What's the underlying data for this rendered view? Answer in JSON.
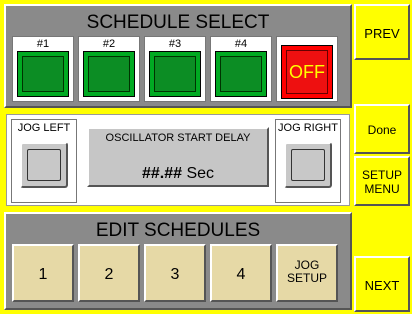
{
  "schedule_select": {
    "title": "SCHEDULE SELECT",
    "slots": [
      {
        "label": "#1"
      },
      {
        "label": "#2"
      },
      {
        "label": "#3"
      },
      {
        "label": "#4"
      }
    ],
    "off_label": "OFF",
    "slot_color": "#00aa22",
    "off_color": "#ff0000"
  },
  "jog": {
    "left_label": "JOG LEFT",
    "right_label": "JOG RIGHT",
    "oscillator_label": "OSCILLATOR START DELAY",
    "oscillator_value": "##.##",
    "oscillator_unit": "Sec"
  },
  "edit_schedules": {
    "title": "EDIT SCHEDULES",
    "buttons": [
      {
        "label": "1"
      },
      {
        "label": "2"
      },
      {
        "label": "3"
      },
      {
        "label": "4"
      }
    ],
    "jog_setup_line1": "JOG",
    "jog_setup_line2": "SETUP",
    "button_color": "#e6d9a6"
  },
  "side_buttons": {
    "prev": "PREV",
    "done": "Done",
    "setup_menu_line1": "SETUP",
    "setup_menu_line2": "MENU",
    "next": "NEXT"
  },
  "colors": {
    "background": "#ffff00",
    "panel": "#8a8a8a"
  }
}
